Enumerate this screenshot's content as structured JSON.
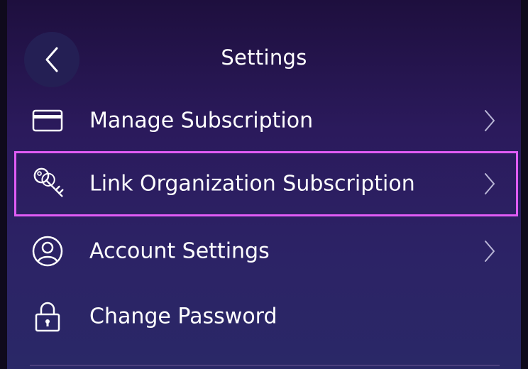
{
  "header": {
    "title": "Settings",
    "back_icon": "chevron-left-icon"
  },
  "menu": {
    "items": [
      {
        "label": "Manage Subscription",
        "icon": "credit-card-icon",
        "chevron": true
      },
      {
        "label": "Link Organization Subscription",
        "icon": "keys-icon",
        "chevron": true,
        "highlighted": true
      },
      {
        "label": "Account Settings",
        "icon": "user-circle-icon",
        "chevron": true
      },
      {
        "label": "Change Password",
        "icon": "lock-icon",
        "chevron": false
      }
    ]
  },
  "colors": {
    "background_top": "#1e0f3e",
    "background_bottom": "#2a2867",
    "highlight_border": "#e05cf5",
    "back_button_bg": "#241f54",
    "text": "#ffffff"
  }
}
